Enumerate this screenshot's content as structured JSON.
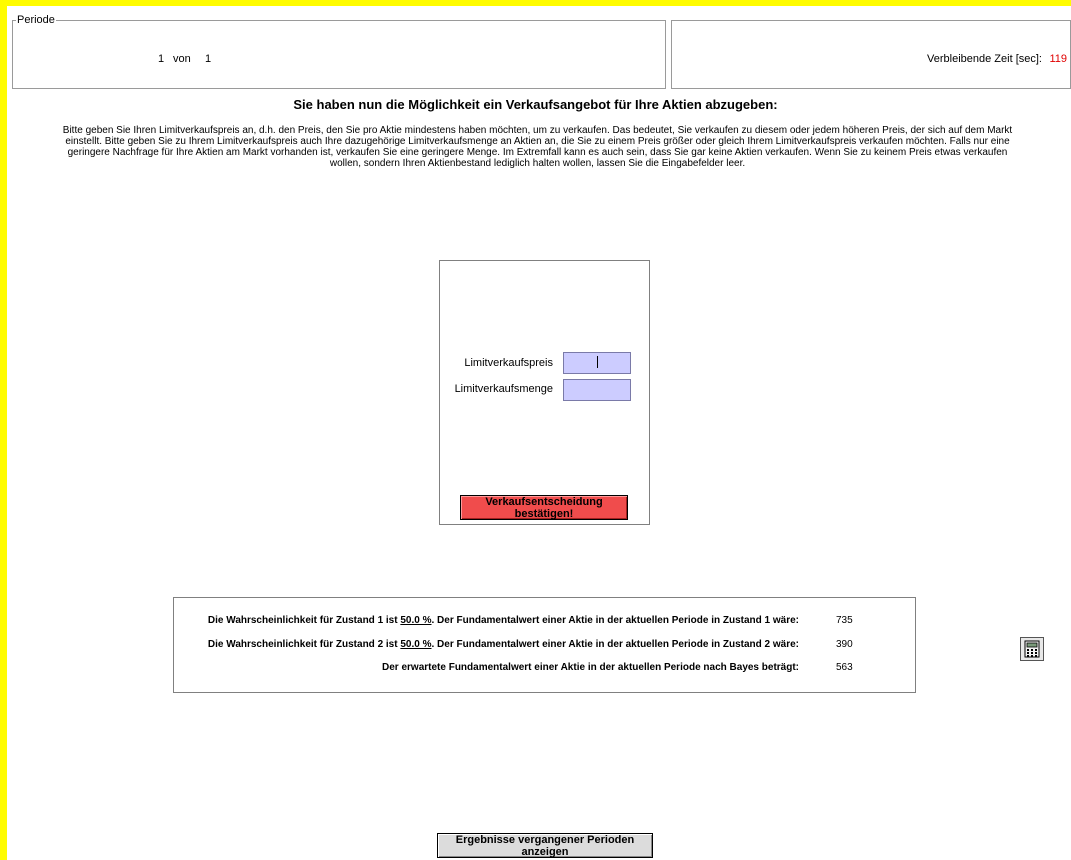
{
  "periode": {
    "title": "Periode",
    "current": "1",
    "of_label": "von",
    "total": "1"
  },
  "timer": {
    "label": "Verbleibende Zeit [sec]:",
    "value": "119",
    "value_color": "#e00000"
  },
  "heading": "Sie haben nun die Möglichkeit ein Verkaufsangebot für Ihre Aktien abzugeben:",
  "instructions": "Bitte geben Sie Ihren Limitverkaufspreis an, d.h. den Preis, den Sie pro Aktie mindestens haben möchten, um zu verkaufen. Das bedeutet, Sie verkaufen zu diesem oder jedem höheren Preis, der sich auf dem Markt einstellt. Bitte geben Sie zu Ihrem Limitverkaufspreis auch Ihre dazugehörige Limitverkaufsmenge an Aktien an, die Sie zu einem Preis größer oder gleich Ihrem Limitverkaufspreis verkaufen möchten. Falls nur eine geringere Nachfrage für Ihre Aktien am Markt vorhanden ist, verkaufen Sie eine geringere Menge. Im Extremfall kann es auch sein, dass Sie gar keine Aktien verkaufen. Wenn Sie zu keinem Preis etwas verkaufen wollen, sondern Ihren Aktienbestand lediglich halten wollen, lassen Sie die Eingabefelder leer.",
  "form": {
    "price_label": "Limitverkaufspreis",
    "price_value": "",
    "quantity_label": "Limitverkaufsmenge",
    "quantity_value": "",
    "input_color": "#ccccff",
    "confirm_label": "Verkaufsentscheidung bestätigen!",
    "confirm_color": "#f04c4c"
  },
  "probabilities": {
    "row1": {
      "prefix": "Die Wahrscheinlichkeit für Zustand 1 ist ",
      "percent": "50.0 %",
      "suffix": ". Der Fundamentalwert einer Aktie in der aktuellen Periode in Zustand 1 wäre:",
      "value": "735"
    },
    "row2": {
      "prefix": "Die Wahrscheinlichkeit für Zustand 2 ist ",
      "percent": "50.0 %",
      "suffix": ". Der Fundamentalwert einer Aktie in der aktuellen Periode in Zustand 2 wäre:",
      "value": "390"
    },
    "row3": {
      "text": "Der erwartete Fundamentalwert einer Aktie in der aktuellen Periode nach Bayes beträgt:",
      "value": "563"
    }
  },
  "calculator_icon": "calculator-icon",
  "history_button": "Ergebnisse vergangener Perioden anzeigen",
  "background_color": "#fffc00"
}
